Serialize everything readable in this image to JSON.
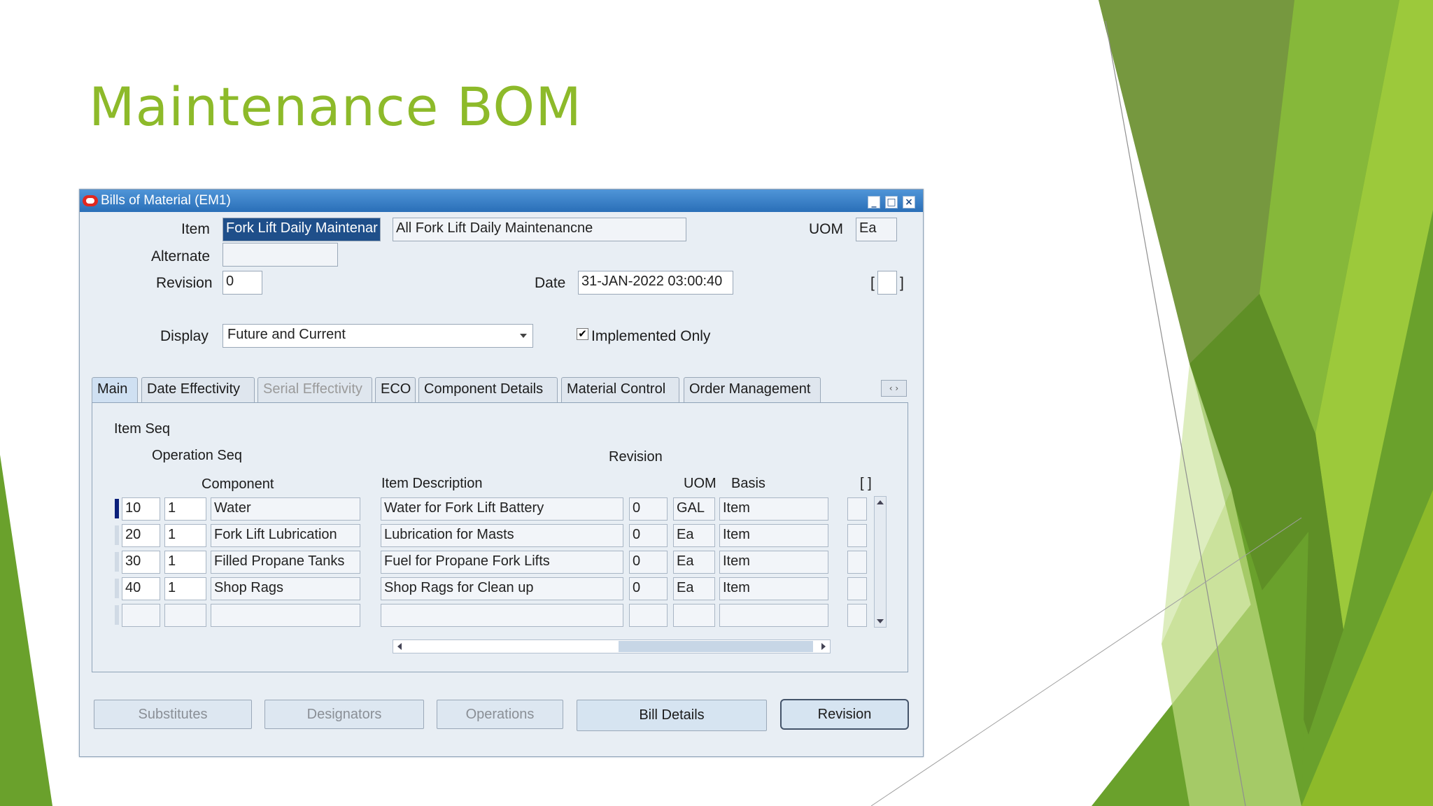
{
  "slide": {
    "title": "Maintenance BOM"
  },
  "window": {
    "title": "Bills of Material (EM1)",
    "controls": {
      "minimize": "_",
      "maximize": "□",
      "close": "×"
    }
  },
  "header": {
    "item_label": "Item",
    "item_value": "Fork Lift Daily Maintenar",
    "item_description": "All Fork Lift Daily Maintenancne",
    "uom_label": "UOM",
    "uom_value": "Ea",
    "alternate_label": "Alternate",
    "alternate_value": "",
    "revision_label": "Revision",
    "revision_value": "0",
    "date_label": "Date",
    "date_value": "31-JAN-2022 03:00:40",
    "bracket_open": "[",
    "bracket_close": "]",
    "bracket_field": "",
    "display_label": "Display",
    "display_value": "Future and Current",
    "implemented_only_label": "Implemented Only",
    "implemented_only_checked": true
  },
  "tabs": [
    {
      "label": "Main",
      "state": "active"
    },
    {
      "label": "Date Effectivity",
      "state": "normal"
    },
    {
      "label": "Serial Effectivity",
      "state": "disabled"
    },
    {
      "label": "ECO",
      "state": "normal"
    },
    {
      "label": "Component Details",
      "state": "normal"
    },
    {
      "label": "Material Control",
      "state": "normal"
    },
    {
      "label": "Order Management",
      "state": "normal"
    }
  ],
  "table": {
    "headers": {
      "item_seq": "Item Seq",
      "operation_seq": "Operation Seq",
      "component": "Component",
      "item_description": "Item Description",
      "revision": "Revision",
      "uom": "UOM",
      "basis": "Basis",
      "bracket": "[ ]"
    },
    "rows": [
      {
        "item_seq": "10",
        "operation_seq": "1",
        "component": "Water",
        "description": "Water for Fork Lift Battery",
        "revision": "0",
        "uom": "GAL",
        "basis": "Item"
      },
      {
        "item_seq": "20",
        "operation_seq": "1",
        "component": "Fork Lift Lubrication",
        "description": "Lubrication for Masts",
        "revision": "0",
        "uom": "Ea",
        "basis": "Item"
      },
      {
        "item_seq": "30",
        "operation_seq": "1",
        "component": "Filled Propane Tanks",
        "description": "Fuel for Propane Fork Lifts",
        "revision": "0",
        "uom": "Ea",
        "basis": "Item"
      },
      {
        "item_seq": "40",
        "operation_seq": "1",
        "component": "Shop Rags",
        "description": "Shop Rags for Clean up",
        "revision": "0",
        "uom": "Ea",
        "basis": "Item"
      },
      {
        "item_seq": "",
        "operation_seq": "",
        "component": "",
        "description": "",
        "revision": "",
        "uom": "",
        "basis": ""
      }
    ]
  },
  "buttons": {
    "substitutes": "Substitutes",
    "designators": "Designators",
    "operations": "Operations",
    "bill_details": "Bill Details",
    "revision": "Revision"
  },
  "colors": {
    "title_green": "#8dba2a",
    "titlebar_blue": "#2a6fb8",
    "window_bg": "#e8eef4"
  }
}
